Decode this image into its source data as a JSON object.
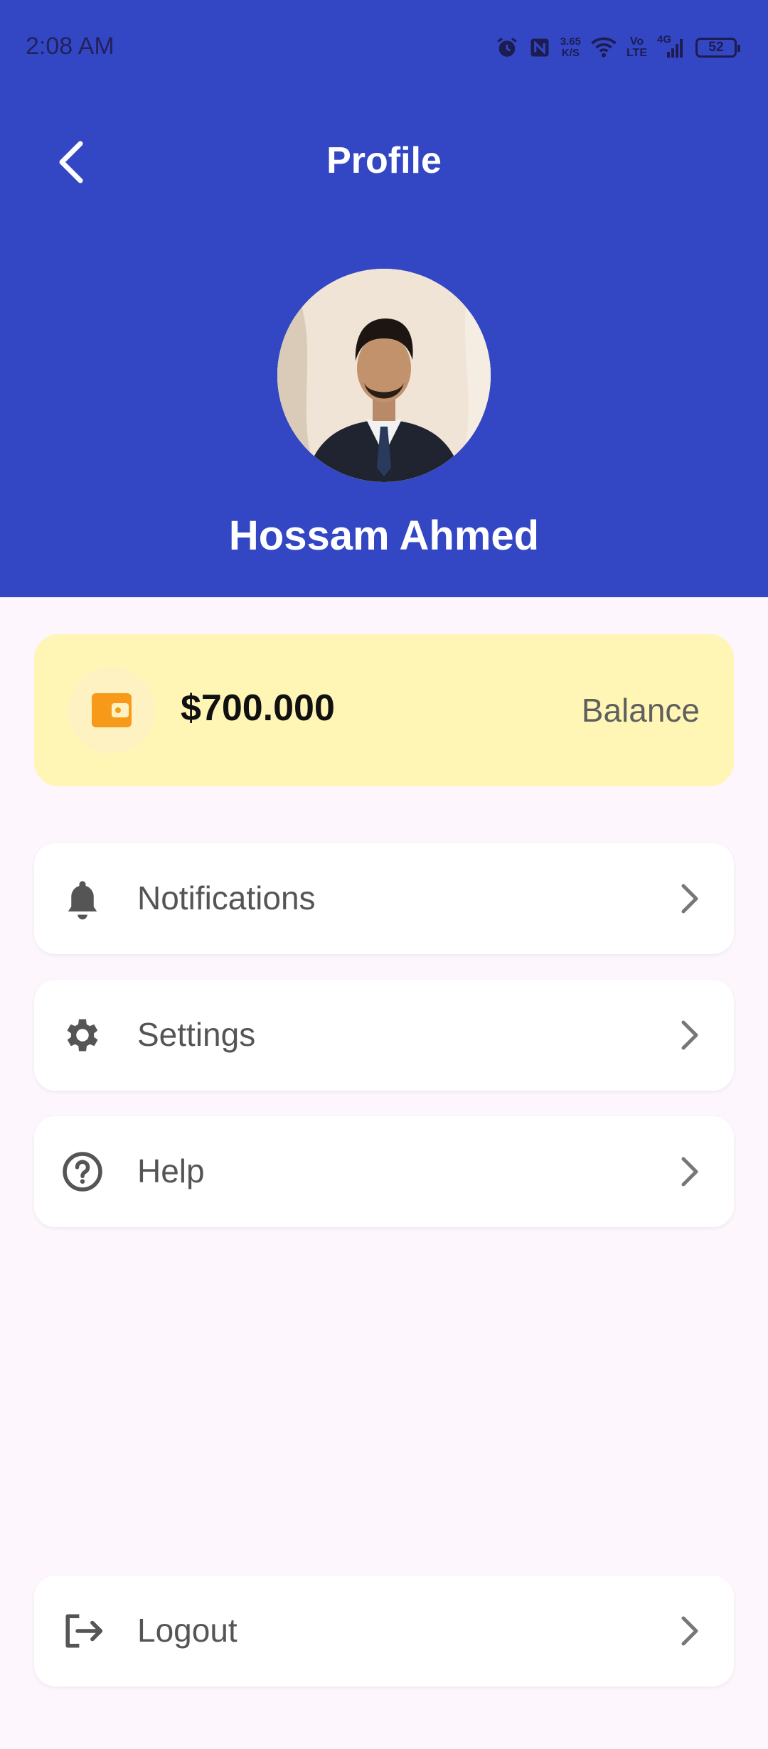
{
  "status_bar": {
    "time": "2:08 AM",
    "net_speed_value": "3.65",
    "net_speed_unit": "K/S",
    "volte_top": "Vo",
    "volte_bottom": "LTE",
    "network_type": "4G",
    "battery_level": "52",
    "icons": [
      "alarm-icon",
      "nfc-icon",
      "wifi-icon",
      "signal-icon",
      "battery-icon"
    ]
  },
  "header": {
    "title": "Profile",
    "back_icon": "chevron-left-icon",
    "background_color": "#3347c4"
  },
  "profile": {
    "name": "Hossam Ahmed"
  },
  "balance": {
    "amount": "$700.000",
    "label": "Balance",
    "icon": "wallet-icon",
    "card_color": "#fff6b5",
    "icon_color": "#f79a1a"
  },
  "menu": {
    "items": [
      {
        "label": "Notifications",
        "icon": "bell-icon"
      },
      {
        "label": "Settings",
        "icon": "gear-icon"
      },
      {
        "label": "Help",
        "icon": "help-circle-icon"
      }
    ],
    "logout": {
      "label": "Logout",
      "icon": "logout-icon"
    }
  }
}
